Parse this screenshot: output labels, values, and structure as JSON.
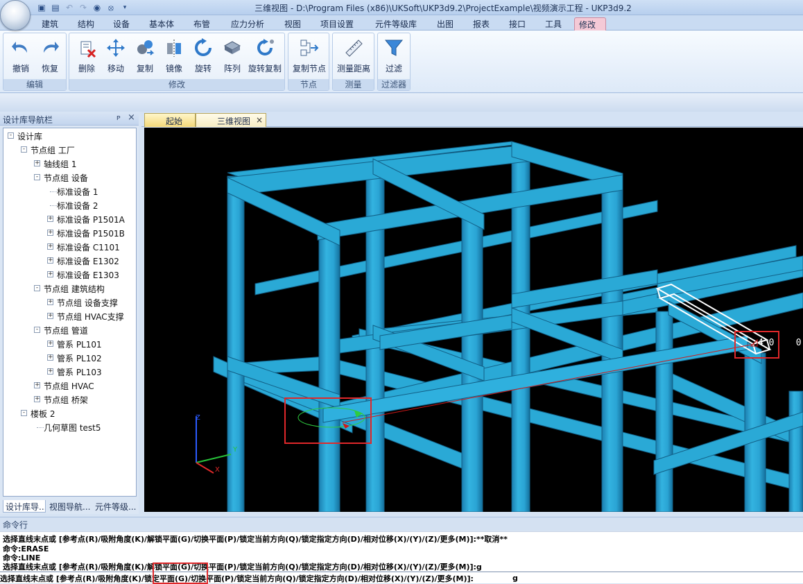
{
  "window": {
    "title": "三维视图 - D:\\Program Files (x86)\\UKSoft\\UKP3d9.2\\ProjectExample\\视频演示工程 - UKP3d9.2"
  },
  "quick_access": [
    "save-icon",
    "saveas-icon",
    "undo-icon",
    "redo-icon",
    "view-icon",
    "hide-icon",
    "dropdown-icon"
  ],
  "ribbon": {
    "tabs": [
      "建筑",
      "结构",
      "设备",
      "基本体",
      "布管",
      "应力分析",
      "视图",
      "项目设置",
      "元件等级库",
      "出图",
      "报表",
      "接口",
      "工具",
      "修改"
    ],
    "active_tab": "修改",
    "groups": [
      {
        "label": "编辑",
        "buttons": [
          "撤销",
          "恢复"
        ]
      },
      {
        "label": "修改",
        "buttons": [
          "删除",
          "移动",
          "复制",
          "镜像",
          "旋转",
          "阵列",
          "旋转复制"
        ]
      },
      {
        "label": "节点",
        "buttons": [
          "复制节点"
        ]
      },
      {
        "label": "测量",
        "buttons": [
          "测量距离"
        ]
      },
      {
        "label": "过滤器",
        "buttons": [
          "过滤"
        ]
      }
    ]
  },
  "navigator": {
    "title": "设计库导航栏",
    "pin": "ᵖ",
    "close": "×",
    "tree": [
      {
        "label": "设计库",
        "level": 0,
        "expander": "-"
      },
      {
        "label": "节点组 工厂",
        "level": 1,
        "expander": "-"
      },
      {
        "label": "轴线组 1",
        "level": 2,
        "expander": "+"
      },
      {
        "label": "节点组 设备",
        "level": 2,
        "expander": "-"
      },
      {
        "label": "标准设备 1",
        "level": 3,
        "expander": ""
      },
      {
        "label": "标准设备 2",
        "level": 3,
        "expander": ""
      },
      {
        "label": "标准设备 P1501A",
        "level": 3,
        "expander": "+"
      },
      {
        "label": "标准设备 P1501B",
        "level": 3,
        "expander": "+"
      },
      {
        "label": "标准设备 C1101",
        "level": 3,
        "expander": "+"
      },
      {
        "label": "标准设备 E1302",
        "level": 3,
        "expander": "+"
      },
      {
        "label": "标准设备 E1303",
        "level": 3,
        "expander": "+"
      },
      {
        "label": "节点组 建筑结构",
        "level": 2,
        "expander": "-"
      },
      {
        "label": "节点组 设备支撑",
        "level": 3,
        "expander": "+"
      },
      {
        "label": "节点组 HVAC支撑",
        "level": 3,
        "expander": "+"
      },
      {
        "label": "节点组 管道",
        "level": 2,
        "expander": "-"
      },
      {
        "label": "管系 PL101",
        "level": 3,
        "expander": "+"
      },
      {
        "label": "管系 PL102",
        "level": 3,
        "expander": "+"
      },
      {
        "label": "管系 PL103",
        "level": 3,
        "expander": "+"
      },
      {
        "label": "节点组 HVAC",
        "level": 2,
        "expander": "+"
      },
      {
        "label": "节点组 桥架",
        "level": 2,
        "expander": "+"
      },
      {
        "label": "楼板 2",
        "level": 1,
        "expander": "-"
      },
      {
        "label": "几何草图 test5",
        "level": 2,
        "expander": ""
      }
    ],
    "bottom_tabs": [
      "设计库导...",
      "视图导航...",
      "元件等级..."
    ]
  },
  "documents": {
    "tabs": [
      "起始页",
      "三维视图"
    ],
    "active": "三维视图",
    "close": "×"
  },
  "viewport": {
    "axis_labels": {
      "z": "Z",
      "y": "Y",
      "x": "X"
    },
    "readout": "4 0    0",
    "colors": {
      "background": "#000000",
      "steel": "#2aa9d6",
      "steel_dark": "#1677a3",
      "selection": "#ffffff",
      "rubber_band": "#d01919",
      "highlight_box": "#e0282a"
    }
  },
  "command": {
    "title": "命令行",
    "history": [
      "选择直线末点或 [参考点(R)/吸附角度(K)/解锁平面(G)/切换平面(P)/锁定当前方向(Q)/锁定指定方向(D)/相对位移(X)/(Y)/(Z)/更多(M)]:**取消**",
      "命令:ERASE",
      "命令:LINE",
      "选择直线末点或 [参考点(R)/吸附角度(K)/解锁平面(G)/切换平面(P)/锁定当前方向(Q)/锁定指定方向(D)/相对位移(X)/(Y)/(Z)/更多(M)]:g"
    ],
    "prompt": "选择直线末点或 [参考点(R)/吸附角度(K)/锁定平面(G)/切换平面(P)/锁定当前方向(Q)/锁定指定方向(D)/相对位移(X)/(Y)/(Z)/更多(M)]:",
    "input_value": "g"
  }
}
